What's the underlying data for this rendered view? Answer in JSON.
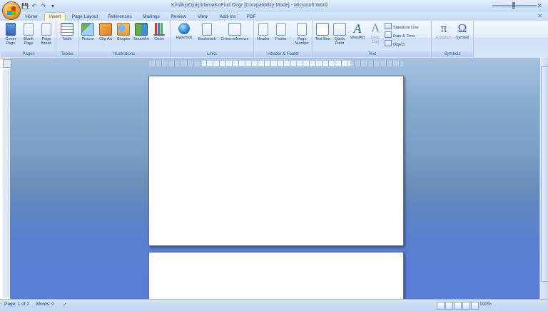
{
  "window": {
    "title": "KimlikçiOyaçıklamaKoFind.Ongr [Compatibility Mode] - Microsoft Word"
  },
  "qat": {
    "save": "💾",
    "undo": "↶",
    "redo": "↷",
    "customize": "▾"
  },
  "tabs": [
    "Home",
    "Insert",
    "Page Layout",
    "References",
    "Mailings",
    "Review",
    "View",
    "Add-Ins",
    "PDF"
  ],
  "active_tab": "Insert",
  "ribbon": {
    "pages": {
      "label": "Pages",
      "cover": "Cover Page",
      "blank": "Blank Page",
      "break": "Page Break"
    },
    "tables": {
      "label": "Tables",
      "table": "Table"
    },
    "illustrations": {
      "label": "Illustrations",
      "picture": "Picture",
      "clipart": "Clip Art",
      "shapes": "Shapes",
      "smartart": "SmartArt",
      "chart": "Chart"
    },
    "links": {
      "label": "Links",
      "hyperlink": "Hyperlink",
      "bookmark": "Bookmark",
      "crossref": "Cross-reference"
    },
    "headerfooter": {
      "label": "Header & Footer",
      "header": "Header",
      "footer": "Footer",
      "pagenum": "Page Number"
    },
    "text": {
      "label": "Text",
      "textbox": "Text Box",
      "quickparts": "Quick Parts",
      "wordart": "WordArt",
      "dropcap": "Drop Cap",
      "sigline": "Signature Line",
      "datetime": "Date & Time",
      "object": "Object"
    },
    "symbols": {
      "label": "Symbols",
      "equation": "Equation",
      "symbol": "Symbol"
    }
  },
  "icons": {
    "wordart_glyph": "A",
    "dropcap_glyph": "A",
    "equation_glyph": "π",
    "symbol_glyph": "Ω",
    "close_glyph": "✕"
  },
  "status": {
    "page": "Page: 1 of 2",
    "words": "Words: 0",
    "zoom": "100%"
  }
}
